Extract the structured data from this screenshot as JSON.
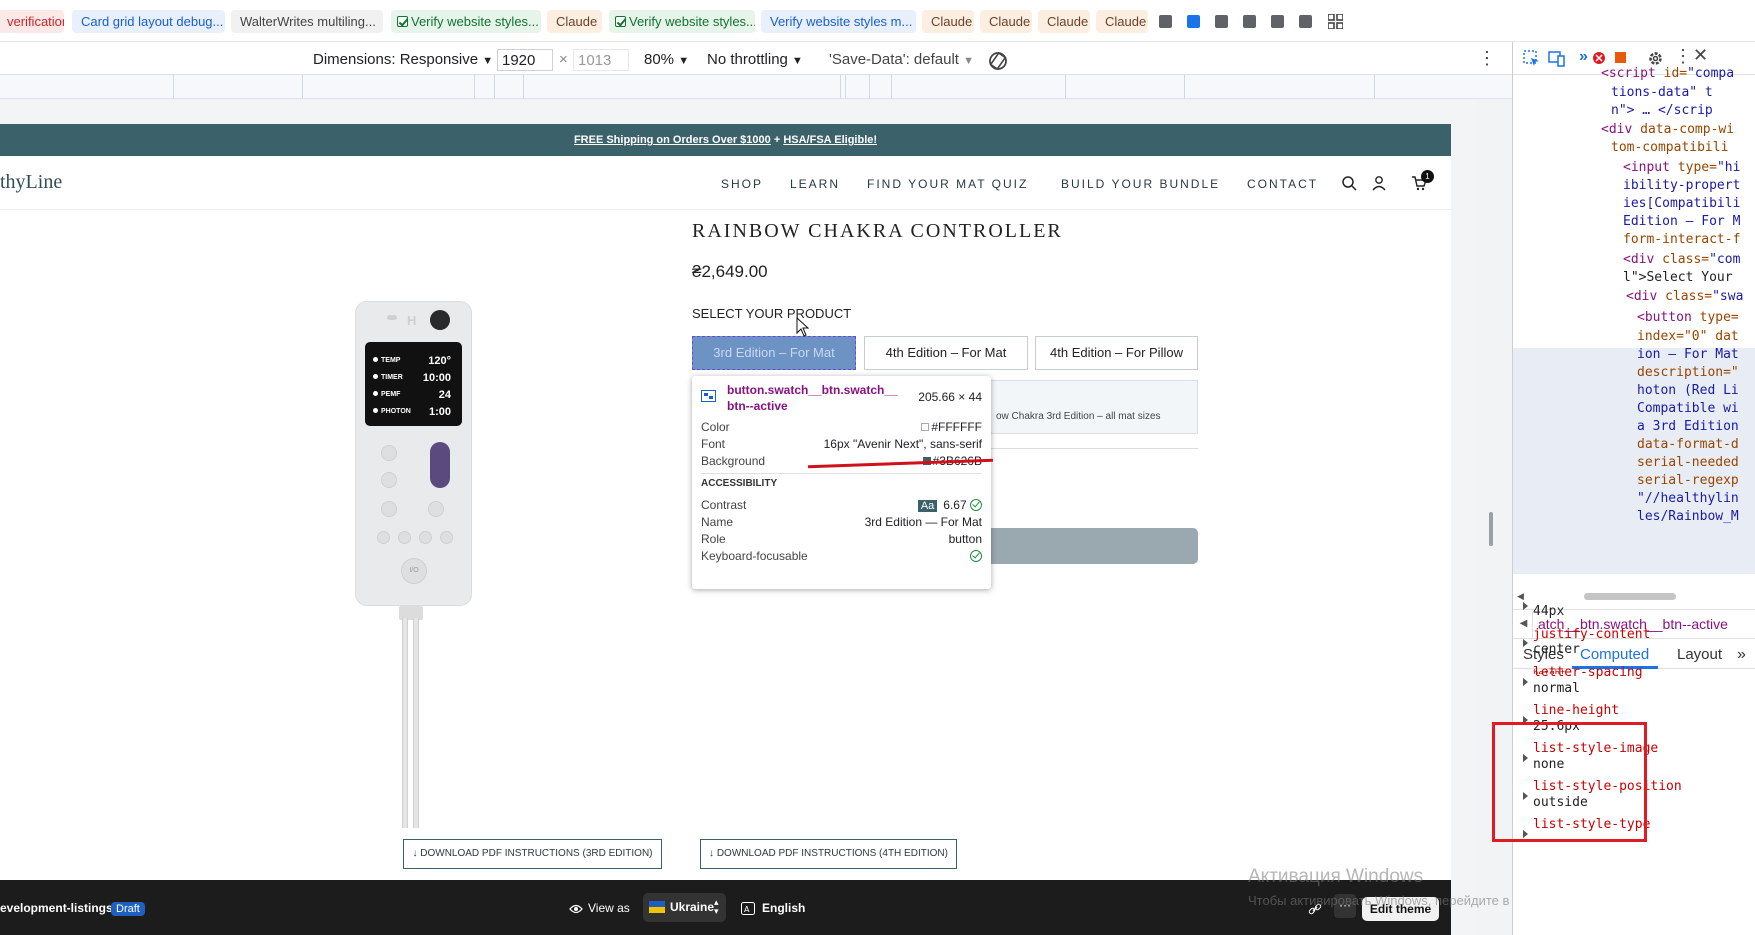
{
  "tabs": [
    {
      "label": "verification",
      "style": "red"
    },
    {
      "label": "Card grid layout debug...",
      "style": "blue"
    },
    {
      "label": "WalterWrites multiling...",
      "style": "gray"
    },
    {
      "label": "Verify website styles...",
      "style": "green"
    },
    {
      "label": "Claude",
      "style": "orange"
    },
    {
      "label": "Verify website styles...",
      "style": "green"
    },
    {
      "label": "Verify website styles m...",
      "style": "blue"
    },
    {
      "label": "Claude",
      "style": "orange"
    },
    {
      "label": "Claude",
      "style": "orange"
    },
    {
      "label": "Claude",
      "style": "orange"
    },
    {
      "label": "Claude",
      "style": "orange"
    }
  ],
  "device_toolbar": {
    "dimensions": "Dimensions: Responsive",
    "width": "1920",
    "times": "×",
    "height": "1013",
    "zoom": "80%",
    "throttling": "No throttling",
    "save_data": "'Save-Data': default"
  },
  "store": {
    "announcement_prefix": "FREE Shipping on Orders Over $1000",
    "announcement_plus": " + ",
    "announcement_link": "HSA/FSA Eligible!",
    "logo": "thyLine",
    "nav": [
      "SHOP",
      "LEARN",
      "FIND YOUR MAT QUIZ",
      "BUILD YOUR BUNDLE",
      "CONTACT"
    ],
    "cart_count": "1",
    "product": {
      "title": "RAINBOW CHAKRA CONTROLLER",
      "price": "₴2,649.00",
      "select_label": "SELECT YOUR PRODUCT",
      "swatches": [
        "3rd Edition – For Mat",
        "4th Edition – For Mat",
        "4th Edition – For Pillow"
      ],
      "description_fragment": "ow Chakra 3rd Edition – all mat sizes",
      "pdf_buttons": [
        "↓ DOWNLOAD PDF INSTRUCTIONS (3RD EDITION)",
        "↓ DOWNLOAD PDF INSTRUCTIONS (4TH EDITION)"
      ]
    },
    "remote_screen": [
      {
        "label": "TEMP",
        "value": "120°"
      },
      {
        "label": "TIMER",
        "value": "10:00"
      },
      {
        "label": "PEMF",
        "value": "24"
      },
      {
        "label": "PHOTON",
        "value": "1:00"
      }
    ],
    "remote_buttons": [
      "I/O"
    ]
  },
  "inspector_tooltip": {
    "selector": "button.swatch__btn.swatch__btn--active",
    "size": "205.66 × 44",
    "rows": [
      {
        "key": "Color",
        "value": "#FFFFFF"
      },
      {
        "key": "Font",
        "value": "16px \"Avenir Next\", sans-serif"
      },
      {
        "key": "Background",
        "value": "#3B626B"
      }
    ],
    "accessibility_heading": "ACCESSIBILITY",
    "contrast_label": "Contrast",
    "contrast_badge": "Aa",
    "contrast_value": "6.67",
    "name_label": "Name",
    "name_value": "3rd Edition — For Mat",
    "role_label": "Role",
    "role_value": "button",
    "focus_label": "Keyboard-focusable",
    "colors": {
      "swatch_white": "#FFFFFF",
      "swatch_bg": "#3B626B"
    }
  },
  "bottom_bar": {
    "theme_name": "evelopment-listings",
    "draft": "Draft",
    "view_as": "View as",
    "country": "Ukraine",
    "language": "English",
    "edit_theme": "Edit theme"
  },
  "watermark": {
    "line1": "Активация Windows",
    "line2": "Чтобы активировать Windows, перейдите в раздел \"Параметры\"."
  },
  "devtools": {
    "elements": [
      {
        "tag": "<script ",
        "attr": "id=",
        "val": "\"compa"
      },
      {
        "tag": "",
        "attr": "",
        "val": "tions-data\" t"
      },
      {
        "tag": "",
        "attr": "",
        "val": "n\"> … </scrip"
      },
      {
        "tag": "<div ",
        "attr": "data-comp-wi",
        "val": ""
      },
      {
        "tag": "",
        "attr": "tom-compatibili",
        "val": ""
      },
      {
        "tag": "<input ",
        "attr": "type=",
        "val": "\"hi"
      },
      {
        "tag": "",
        "attr": "ibility-propert",
        "val": ""
      },
      {
        "tag": "",
        "attr": "ies[Compatibili",
        "val": ""
      },
      {
        "tag": "",
        "attr": "Edition – For M",
        "val": ""
      },
      {
        "tag": "",
        "attr": "form-interact-f",
        "val": ""
      },
      {
        "tag": "<div ",
        "attr": "class=",
        "val": "\"com"
      },
      {
        "tag": "",
        "attr": "l\">Select Your",
        "val": ""
      },
      {
        "tag": "<div ",
        "attr": "class=",
        "val": "\"swa"
      },
      {
        "tag": "<button ",
        "attr": "type=",
        "val": ""
      },
      {
        "tag": "",
        "attr": "index=\"0\" dat",
        "val": ""
      },
      {
        "tag": "",
        "attr": "ion – For Mat",
        "val": ""
      },
      {
        "tag": "",
        "attr": "description=\"",
        "val": ""
      },
      {
        "tag": "",
        "attr": "hoton (Red Li",
        "val": ""
      },
      {
        "tag": "",
        "attr": "Compatible wi",
        "val": ""
      },
      {
        "tag": "",
        "attr": "a 3rd Edition",
        "val": ""
      },
      {
        "tag": "",
        "attr": "data-format-d",
        "val": ""
      },
      {
        "tag": "",
        "attr": "serial-needed",
        "val": ""
      },
      {
        "tag": "",
        "attr": "serial-regexp",
        "val": ""
      },
      {
        "tag": "",
        "attr": "\"//healthylin",
        "val": ""
      },
      {
        "tag": "",
        "attr": "les/Rainbow_M",
        "val": ""
      }
    ],
    "breadcrumb": "atch__btn.swatch__btn--active",
    "style_tabs": [
      "Styles",
      "Computed",
      "Layout"
    ],
    "active_style_tab": "Computed",
    "computed": [
      {
        "prop": "height",
        "val": "44px"
      },
      {
        "prop": "justify-content",
        "val": "center"
      },
      {
        "prop": "letter-spacing",
        "val": "normal"
      },
      {
        "prop": "line-height",
        "val": "25.6px"
      },
      {
        "prop": "list-style-image",
        "val": "none"
      },
      {
        "prop": "list-style-position",
        "val": "outside"
      },
      {
        "prop": "list-style-type",
        "val": ""
      }
    ]
  }
}
